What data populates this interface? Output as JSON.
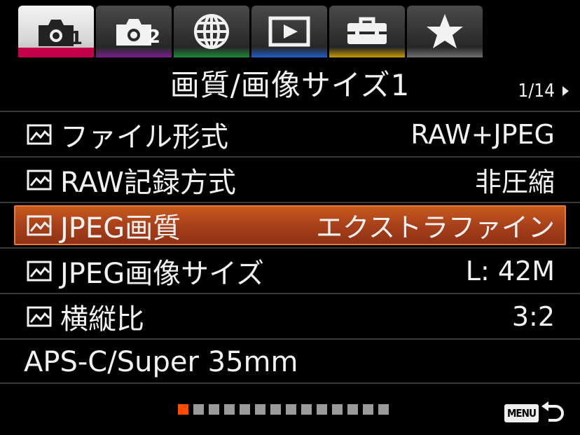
{
  "tabs": [
    {
      "name": "camera-settings-1",
      "icon": "camera-icon",
      "num": "1",
      "color": "#c4004a",
      "active": true
    },
    {
      "name": "camera-settings-2",
      "icon": "camera-icon",
      "num": "2",
      "color": "#8a1fa3",
      "active": false
    },
    {
      "name": "network",
      "icon": "globe-icon",
      "num": "",
      "color": "#1a8f3a",
      "active": false
    },
    {
      "name": "playback",
      "icon": "playback-icon",
      "num": "",
      "color": "#1f5fd0",
      "active": false
    },
    {
      "name": "setup",
      "icon": "toolbox-icon",
      "num": "",
      "color": "#d4a300",
      "active": false
    },
    {
      "name": "my-menu",
      "icon": "star-icon",
      "num": "",
      "color": "#888888",
      "active": false
    }
  ],
  "header": {
    "title": "画質/画像サイズ1",
    "page_indicator": "1/14"
  },
  "rows": [
    {
      "label": "ファイル形式",
      "value": "RAW+JPEG",
      "icon": "still-image-icon",
      "selected": false
    },
    {
      "label": "RAW記録方式",
      "value": "非圧縮",
      "icon": "still-image-icon",
      "selected": false
    },
    {
      "label": "JPEG画質",
      "value": "エクストラファイン",
      "icon": "still-image-icon",
      "selected": true
    },
    {
      "label": "JPEG画像サイズ",
      "value": "L: 42M",
      "icon": "still-image-icon",
      "selected": false
    },
    {
      "label": "横縦比",
      "value": "3:2",
      "icon": "still-image-icon",
      "selected": false
    },
    {
      "label": "APS-C/Super 35mm",
      "value": "",
      "icon": "",
      "selected": false
    }
  ],
  "pagination": {
    "total": 14,
    "current": 1,
    "active_color": "#ff4a00"
  },
  "footer": {
    "menu_label": "MENU",
    "back_icon": "return-arrow-icon"
  }
}
